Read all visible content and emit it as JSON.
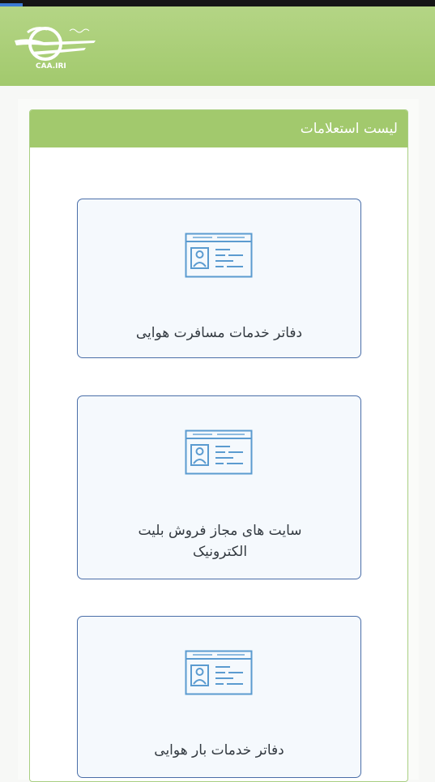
{
  "header": {
    "logo_text": "CAA.IRI"
  },
  "panel": {
    "title": "لیست استعلامات"
  },
  "tiles": [
    {
      "label": "دفاتر خدمات مسافرت هوایی",
      "icon": "id-card-icon"
    },
    {
      "label": "سایت های مجاز فروش بلیت الکترونیک",
      "icon": "id-card-icon"
    },
    {
      "label": "دفاتر خدمات بار هوایی",
      "icon": "id-card-icon"
    }
  ],
  "colors": {
    "header_green": "#a2c96d",
    "tile_border": "#4a6ea8",
    "icon_blue": "#5b9bd0"
  }
}
